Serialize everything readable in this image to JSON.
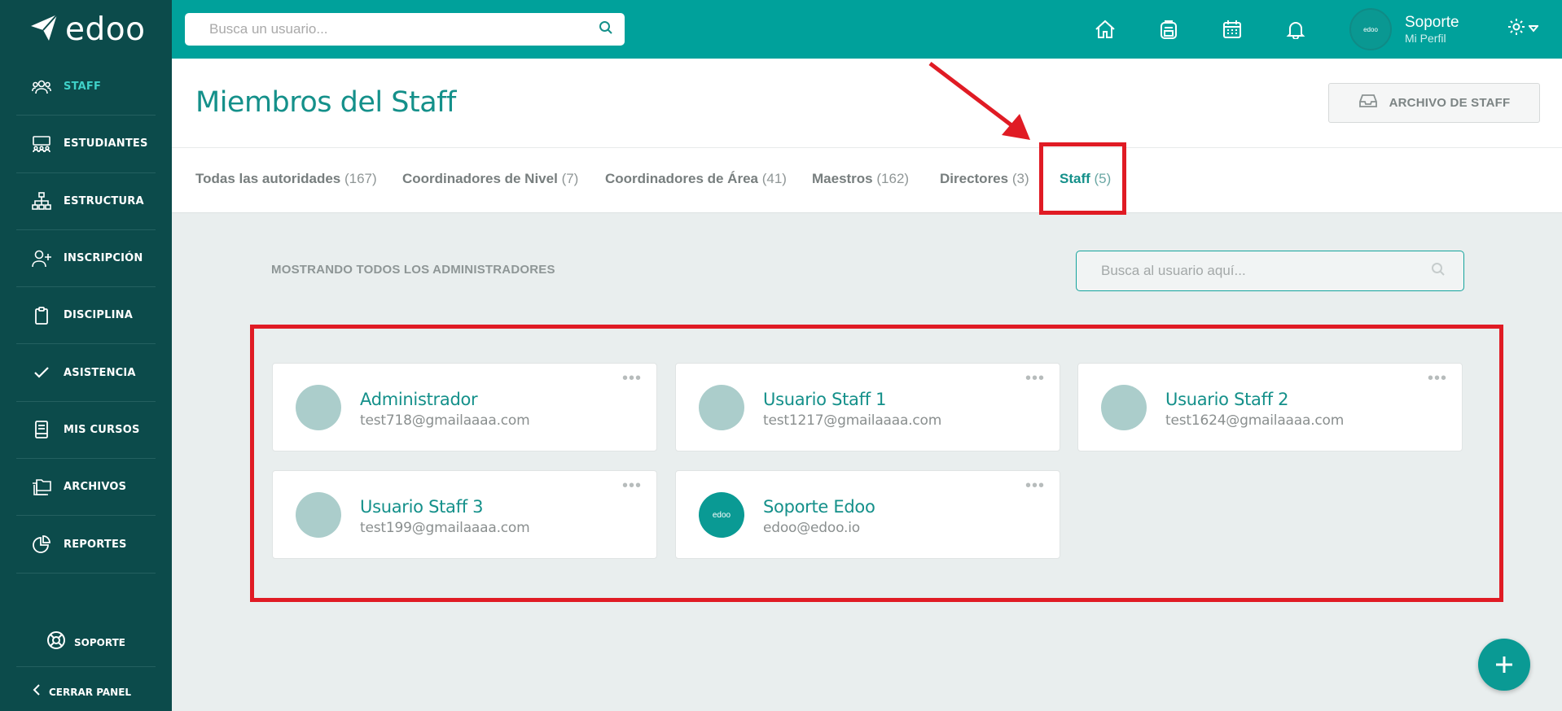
{
  "app": {
    "logo_text": "edoo"
  },
  "sidebar": {
    "items": [
      {
        "label": "STAFF",
        "icon": "users-icon",
        "active": true
      },
      {
        "label": "ESTUDIANTES",
        "icon": "students-icon"
      },
      {
        "label": "ESTRUCTURA",
        "icon": "hierarchy-icon"
      },
      {
        "label": "INSCRIPCIÓN",
        "icon": "user-plus-icon"
      },
      {
        "label": "DISCIPLINA",
        "icon": "clipboard-icon"
      },
      {
        "label": "ASISTENCIA",
        "icon": "check-icon"
      },
      {
        "label": "MIS CURSOS",
        "icon": "book-icon"
      },
      {
        "label": "ARCHIVOS",
        "icon": "folders-icon"
      },
      {
        "label": "REPORTES",
        "icon": "pie-chart-icon"
      }
    ],
    "support_label": "SOPORTE",
    "close_label": "CERRAR PANEL"
  },
  "topbar": {
    "search_placeholder": "Busca un usuario...",
    "profile_name": "Soporte",
    "profile_sub": "Mi Perfil",
    "avatar_text": "edoo"
  },
  "header": {
    "title": "Miembros del Staff",
    "archive_button": "ARCHIVO DE STAFF"
  },
  "tabs": [
    {
      "label": "Todas las autoridades",
      "count": "(167)"
    },
    {
      "label": "Coordinadores de Nivel",
      "count": "(7)"
    },
    {
      "label": "Coordinadores de Área",
      "count": "(41)"
    },
    {
      "label": "Maestros",
      "count": "(162)"
    },
    {
      "label": "Directores",
      "count": "(3)"
    },
    {
      "label": "Staff",
      "count": "(5)",
      "active": true
    }
  ],
  "list": {
    "showing_label": "MOSTRANDO TODOS LOS ADMINISTRADORES",
    "search_placeholder": "Busca al usuario aquí...",
    "members": [
      {
        "name": "Administrador",
        "email": "test718@gmailaaaa.com"
      },
      {
        "name": "Usuario Staff 1",
        "email": "test1217@gmailaaaa.com"
      },
      {
        "name": "Usuario Staff 2",
        "email": "test1624@gmailaaaa.com"
      },
      {
        "name": "Usuario Staff 3",
        "email": "test199@gmailaaaa.com"
      },
      {
        "name": "Soporte Edoo",
        "email": "edoo@edoo.io",
        "avatar_text": "edoo"
      }
    ]
  },
  "colors": {
    "sidebar": "#0c4b4b",
    "topbar": "#00a19b",
    "accent": "#14908a",
    "annotation": "#e01b24"
  }
}
